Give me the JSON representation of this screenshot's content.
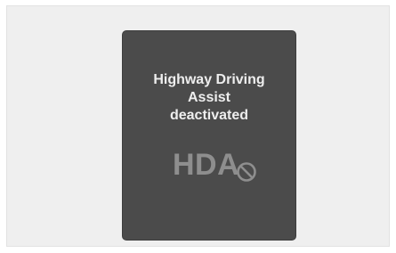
{
  "notice": {
    "message": "Highway Driving\nAssist\ndeactivated",
    "indicator_text": "HDA",
    "indicator_icon": "prohibited-icon",
    "colors": {
      "panel_bg": "#4b4b4b",
      "message_text": "#eeeeee",
      "indicator": "#8e8e8e",
      "page_bg": "#efefef"
    }
  }
}
